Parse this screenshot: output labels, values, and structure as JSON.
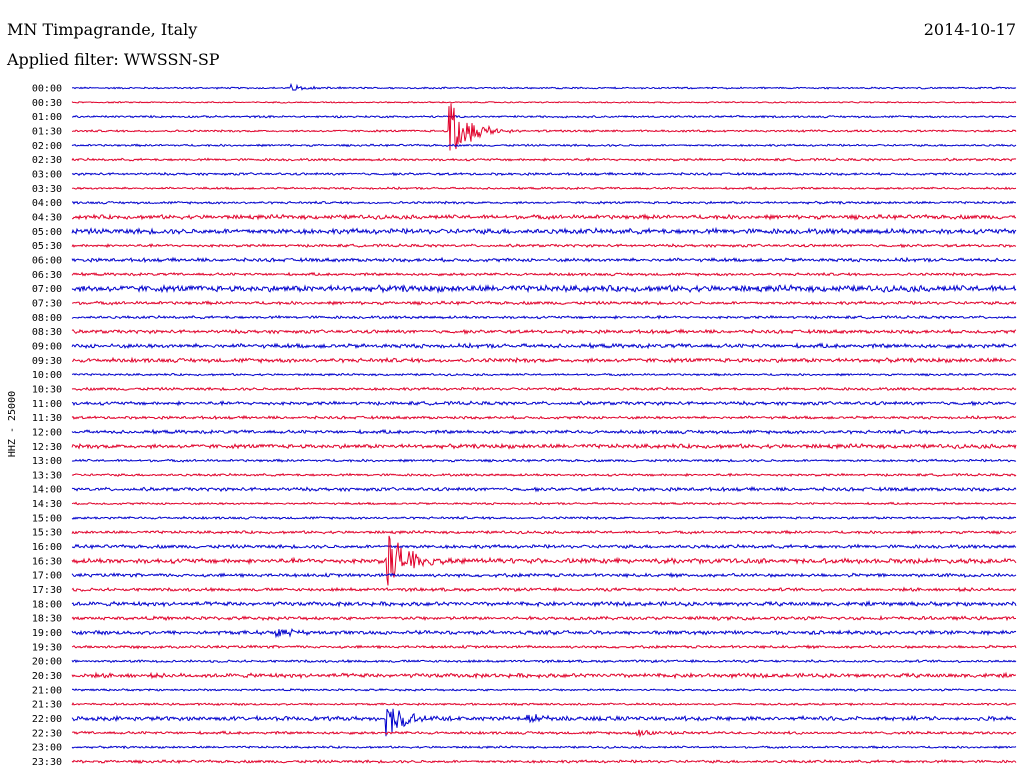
{
  "header": {
    "station": "MN Timpagrande, Italy",
    "date": "2014-10-17",
    "filter": "Applied filter: WWSSN-SP"
  },
  "chart_data": {
    "type": "line",
    "description_of_layout": "",
    "ylabel": "HHZ - 25000",
    "rows": [
      "00:00",
      "00:30",
      "01:00",
      "01:30",
      "02:00",
      "02:30",
      "03:00",
      "03:30",
      "04:00",
      "04:30",
      "05:00",
      "05:30",
      "06:00",
      "06:30",
      "07:00",
      "07:30",
      "08:00",
      "08:30",
      "09:00",
      "09:30",
      "10:00",
      "10:30",
      "11:00",
      "11:30",
      "12:00",
      "12:30",
      "13:00",
      "13:30",
      "14:00",
      "14:30",
      "15:00",
      "15:30",
      "16:00",
      "16:30",
      "17:00",
      "17:30",
      "18:00",
      "18:30",
      "19:00",
      "19:30",
      "20:00",
      "20:30",
      "21:00",
      "21:30",
      "22:00",
      "22:30",
      "23:00",
      "23:30"
    ],
    "series_colors": [
      "#0000cc",
      "#e0002a"
    ],
    "events": [
      {
        "row": "00:00",
        "at_minute": 7,
        "amplitude": 0.2
      },
      {
        "row": "01:30",
        "at_minute": 12,
        "amplitude": 2.2
      },
      {
        "row": "16:30",
        "at_minute": 10,
        "amplitude": 2.6
      },
      {
        "row": "19:00",
        "at_minute": 6.5,
        "amplitude": 0.5
      },
      {
        "row": "22:00",
        "at_minute": 10,
        "amplitude": 1.3
      },
      {
        "row": "22:00",
        "at_minute": 14.5,
        "amplitude": 0.25
      },
      {
        "row": "22:30",
        "at_minute": 18,
        "amplitude": 0.2
      }
    ],
    "noise_levels": [
      0.05,
      0.04,
      0.06,
      0.06,
      0.06,
      0.07,
      0.07,
      0.06,
      0.07,
      0.12,
      0.15,
      0.08,
      0.1,
      0.08,
      0.18,
      0.09,
      0.08,
      0.1,
      0.12,
      0.12,
      0.06,
      0.08,
      0.1,
      0.08,
      0.1,
      0.12,
      0.07,
      0.07,
      0.1,
      0.06,
      0.07,
      0.08,
      0.1,
      0.14,
      0.1,
      0.09,
      0.12,
      0.1,
      0.11,
      0.08,
      0.07,
      0.12,
      0.06,
      0.06,
      0.12,
      0.08,
      0.06,
      0.08
    ]
  }
}
